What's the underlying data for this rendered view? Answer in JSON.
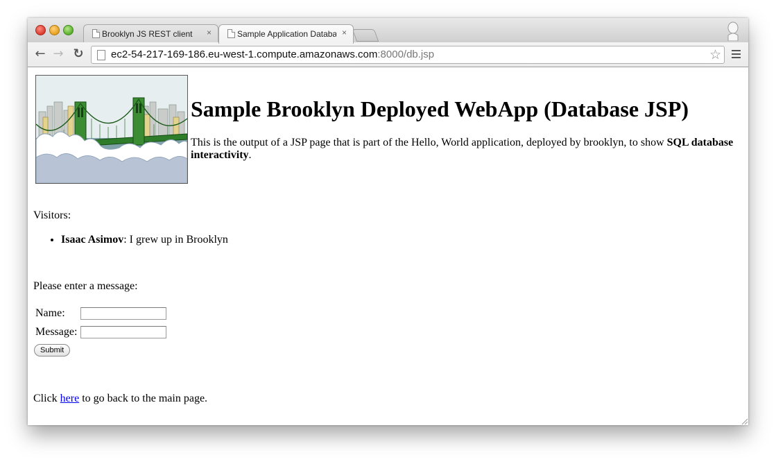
{
  "browser": {
    "tabs": [
      {
        "title": "Brooklyn JS REST client",
        "active": false
      },
      {
        "title": "Sample Application Database",
        "active": true
      }
    ],
    "tab_close_glyph": "×",
    "address": {
      "host": "ec2-54-217-169-186.eu-west-1.compute.amazonaws.com",
      "path": ":8000/db.jsp"
    }
  },
  "page": {
    "heading": "Sample Brooklyn Deployed WebApp (Database JSP)",
    "intro_text": "This is the output of a JSP page that is part of the Hello, World application, deployed by brooklyn, to show ",
    "intro_bold": "SQL database interactivity",
    "intro_end": ".",
    "visitors_label": "Visitors:",
    "visitors": [
      {
        "name": "Isaac Asimov",
        "message": ": I grew up in Brooklyn"
      }
    ],
    "prompt": "Please enter a message:",
    "form": {
      "name_label": "Name:",
      "message_label": "Message:",
      "name_value": "",
      "message_value": "",
      "submit_label": "Submit"
    },
    "footer": {
      "before": "Click ",
      "link": "here",
      "after": " to go back to the main page."
    }
  },
  "icons": [
    "back-arrow-icon",
    "forward-arrow-icon",
    "reload-icon",
    "page-icon",
    "star-icon",
    "menu-icon",
    "profile-icon",
    "document-icon",
    "close-icon",
    "brooklyn-bridge-logo"
  ]
}
